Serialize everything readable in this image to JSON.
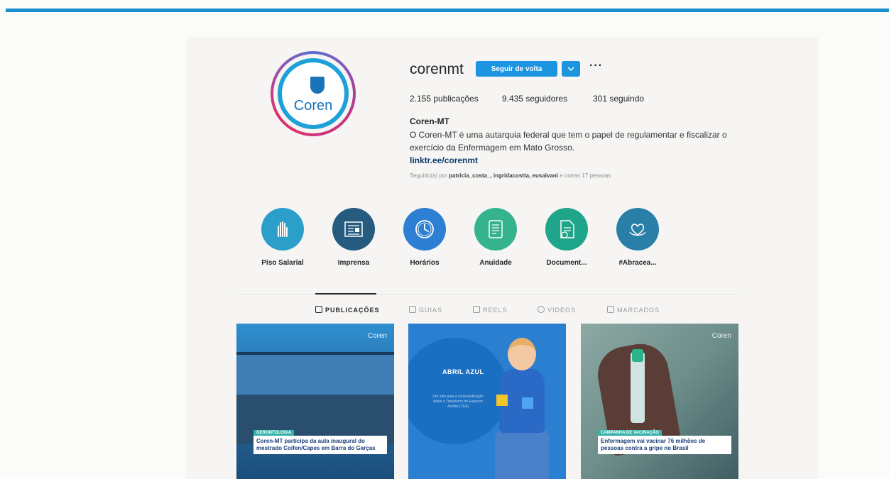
{
  "profile": {
    "username": "corenmt",
    "follow_button": "Seguir de volta",
    "more": "···",
    "avatar_text": "Coren",
    "stats": {
      "posts": "2.155 publicações",
      "followers": "9.435 seguidores",
      "following": "301 seguindo"
    },
    "full_name": "Coren-MT",
    "bio": "O Coren-MT é uma autarquia federal que tem o papel de regulamentar e fiscalizar o exercício da Enfermagem em Mato Grosso.",
    "link": "linktr.ee/corenmt",
    "followed_by_prefix": "Seguido(a) por ",
    "followed_by_names": "patricia_costa_, ingridacostta, eusaivani",
    "followed_by_suffix": " e outras 17 pessoas"
  },
  "highlights": [
    {
      "label": "Piso Salarial",
      "icon": "hand-icon",
      "color": "#2b9fc9"
    },
    {
      "label": "Imprensa",
      "icon": "news-icon",
      "color": "#245b7e"
    },
    {
      "label": "Horários",
      "icon": "clock-icon",
      "color": "#2d7fd4"
    },
    {
      "label": "Anuidade",
      "icon": "invoice-icon",
      "color": "#34b38c"
    },
    {
      "label": "Document...",
      "icon": "document-icon",
      "color": "#1fa58a"
    },
    {
      "label": "#Abracea...",
      "icon": "heart-hands-icon",
      "color": "#2a7fa9"
    }
  ],
  "tabs": [
    {
      "label": "PUBLICAÇÕES",
      "active": true
    },
    {
      "label": "GUIAS",
      "active": false
    },
    {
      "label": "REELS",
      "active": false
    },
    {
      "label": "VÍDEOS",
      "active": false
    },
    {
      "label": "MARCADOS",
      "active": false
    }
  ],
  "posts": [
    {
      "logo": "Coren",
      "tag": "GERONTOLOGIA",
      "caption": "Coren-MT participa da aula inaugural do mestrado Coifen/Capes em Barra do Garças"
    },
    {
      "title": "ABRIL AZUL",
      "subtitle": "Um mês para a conscientização sobre o Transtorno do Espectro Autista (TEA)"
    },
    {
      "logo": "Coren",
      "tag": "CAMPANHA DE VACINAÇÃO",
      "caption": "Enfermagem vai vacinar 76 milhões de pessoas contra a gripe no Brasil"
    }
  ],
  "colors": {
    "accent": "#1c95e0",
    "top_bar": "#1a8fcf"
  }
}
